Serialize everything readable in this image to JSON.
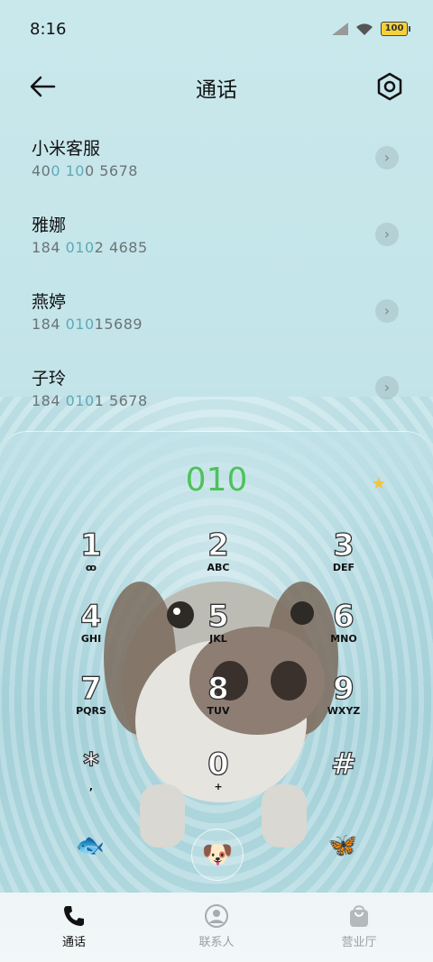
{
  "status_bar": {
    "time": "8:16",
    "battery": "100"
  },
  "header": {
    "title": "通话"
  },
  "contacts": [
    {
      "name": "小米客服",
      "number_pre": "40",
      "number_hl": "0 10",
      "number_post": "0 5678"
    },
    {
      "name": "雅娜",
      "number_pre": "184 ",
      "number_hl": "010",
      "number_post": "2 4685"
    },
    {
      "name": "燕婷",
      "number_pre": "184 ",
      "number_hl": "010",
      "number_post": "15689"
    },
    {
      "name": "子玲",
      "number_pre": "184 ",
      "number_hl": "010",
      "number_post": "1 5678"
    }
  ],
  "dialer": {
    "entered_number": "010",
    "keys": [
      {
        "digit": "1",
        "letters": "ꝏ"
      },
      {
        "digit": "2",
        "letters": "ABC"
      },
      {
        "digit": "3",
        "letters": "DEF"
      },
      {
        "digit": "4",
        "letters": "GHI"
      },
      {
        "digit": "5",
        "letters": "JKL"
      },
      {
        "digit": "6",
        "letters": "MNO"
      },
      {
        "digit": "7",
        "letters": "PQRS"
      },
      {
        "digit": "8",
        "letters": "TUV"
      },
      {
        "digit": "9",
        "letters": "WXYZ"
      },
      {
        "digit": "*",
        "letters": ","
      },
      {
        "digit": "0",
        "letters": "+"
      },
      {
        "digit": "#",
        "letters": ""
      }
    ]
  },
  "tabs": [
    {
      "label": "通话",
      "icon": "phone-icon",
      "active": true
    },
    {
      "label": "联系人",
      "icon": "contact-icon",
      "active": false
    },
    {
      "label": "营业厅",
      "icon": "bag-icon",
      "active": false
    }
  ],
  "colors": {
    "accent_green": "#4ec25a",
    "highlight_blue": "#5fa9b8"
  }
}
